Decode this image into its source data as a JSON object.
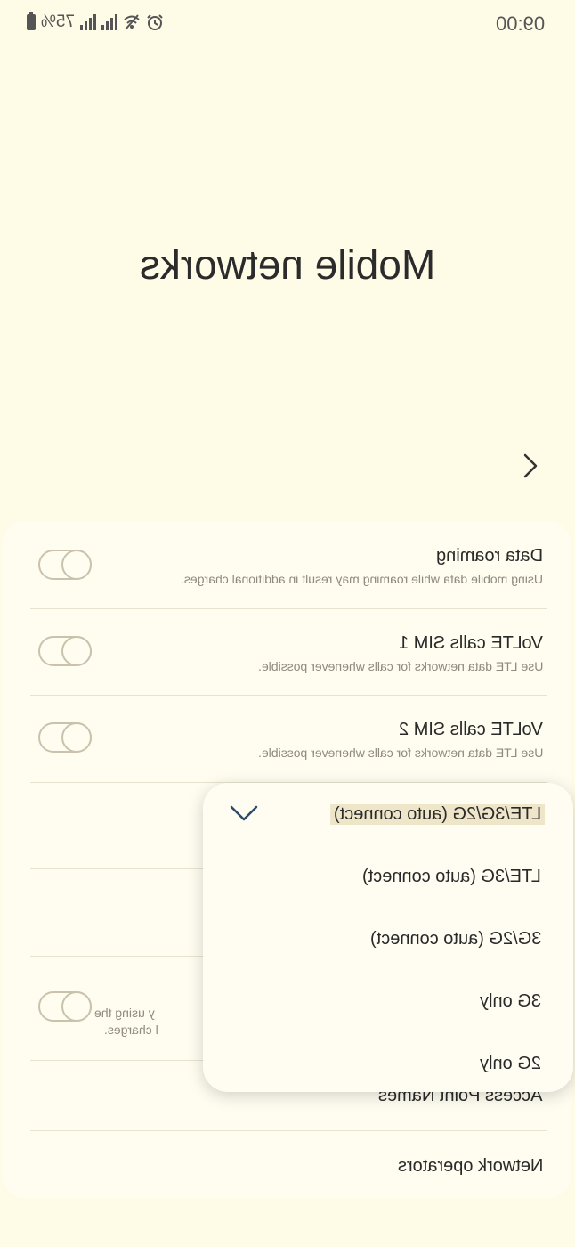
{
  "status_bar": {
    "battery_text": "75%",
    "time": "09:00",
    "icons": [
      "battery-icon",
      "signal-sim1-icon",
      "signal-sim2-icon",
      "wifi-off-icon",
      "alarm-icon"
    ]
  },
  "page": {
    "title": "Mobile networks"
  },
  "settings": {
    "data_roaming": {
      "title": "Data roaming",
      "subtitle": "Using mobile data while roaming may result in additional charges."
    },
    "volte_sim1": {
      "title": "VoLTE calls SIM 1",
      "subtitle": "Use LTE data networks for calls whenever possible."
    },
    "volte_sim2": {
      "title": "VoLTE calls SIM 2",
      "subtitle": "Use LTE data networks for calls whenever possible."
    },
    "partial_row": {
      "subtitle_line1": "y using the",
      "subtitle_line2": "l charges."
    },
    "access_point_names": {
      "title": "Access Point Names"
    },
    "network_operators": {
      "title": "Network operators"
    }
  },
  "network_mode_dropdown": {
    "selected": "LTE/3G/2G (auto connect)",
    "options": [
      "LTE/3G (auto connect)",
      "3G/2G (auto connect)",
      "3G only",
      "2G only"
    ]
  }
}
